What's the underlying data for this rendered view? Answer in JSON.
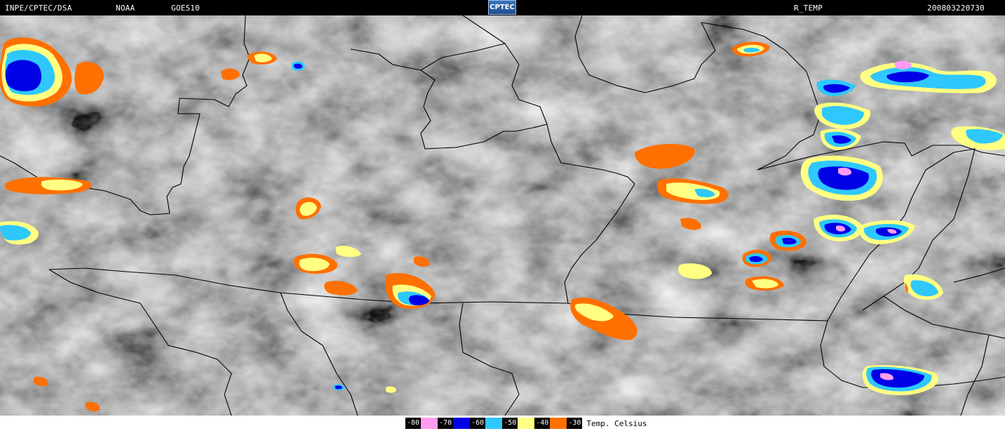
{
  "header": {
    "source": "INPE/CPTEC/DSA",
    "agency": "NOAA",
    "satellite": "GOES10",
    "logo_text": "CPTEC",
    "product": "R_TEMP",
    "timestamp": "200803220730"
  },
  "legend": {
    "unit_label": "Temp. Celsius",
    "entries": [
      {
        "label": "-80",
        "color": "#ff9cf2"
      },
      {
        "label": "-70",
        "color": "#0000e6"
      },
      {
        "label": "-60",
        "color": "#2ec8ff"
      },
      {
        "label": "-50",
        "color": "#ffff82"
      },
      {
        "label": "-40",
        "color": "#ff7000"
      },
      {
        "label": "-30",
        "color": ""
      }
    ]
  },
  "map": {
    "background_gray": "#7e7e7e",
    "border_color": "#000000"
  }
}
